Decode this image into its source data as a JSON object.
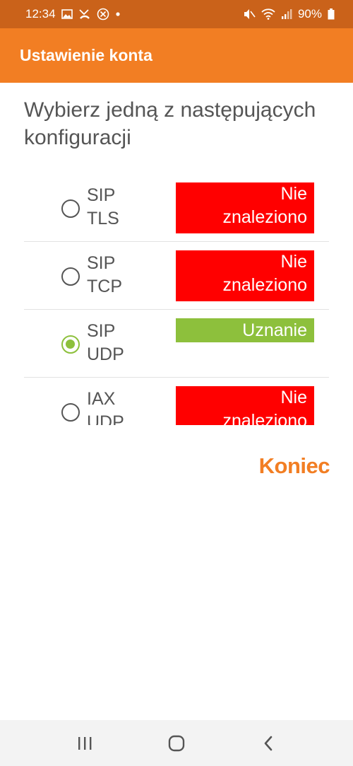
{
  "status_bar": {
    "time": "12:34",
    "battery": "90%",
    "left_icons": [
      "gallery-icon",
      "missed-call-icon",
      "blocked-icon",
      "dot-icon"
    ],
    "right_icons": [
      "mute-icon",
      "wifi-icon",
      "signal-icon",
      "battery-icon"
    ]
  },
  "app_bar": {
    "title": "Ustawienie konta"
  },
  "heading": "Wybierz jedną z następujących konfiguracji",
  "options": [
    {
      "protocol": "SIP\nTLS",
      "status": "Nie\nznaleziono",
      "status_type": "error",
      "selected": false
    },
    {
      "protocol": "SIP\nTCP",
      "status": "Nie\nznaleziono",
      "status_type": "error",
      "selected": false
    },
    {
      "protocol": "SIP\nUDP",
      "status": "Uznanie",
      "status_type": "ok",
      "selected": true
    },
    {
      "protocol": "IAX\nUDP",
      "status": "Nie\nznaleziono",
      "status_type": "error",
      "selected": false
    }
  ],
  "finish_label": "Koniec",
  "colors": {
    "accent": "#f27e23",
    "status_bar": "#ca621a",
    "error": "#ff0000",
    "ok": "#8dc03c"
  },
  "nav_bar": {
    "buttons": [
      "recent-apps-icon",
      "home-icon",
      "back-icon"
    ]
  }
}
